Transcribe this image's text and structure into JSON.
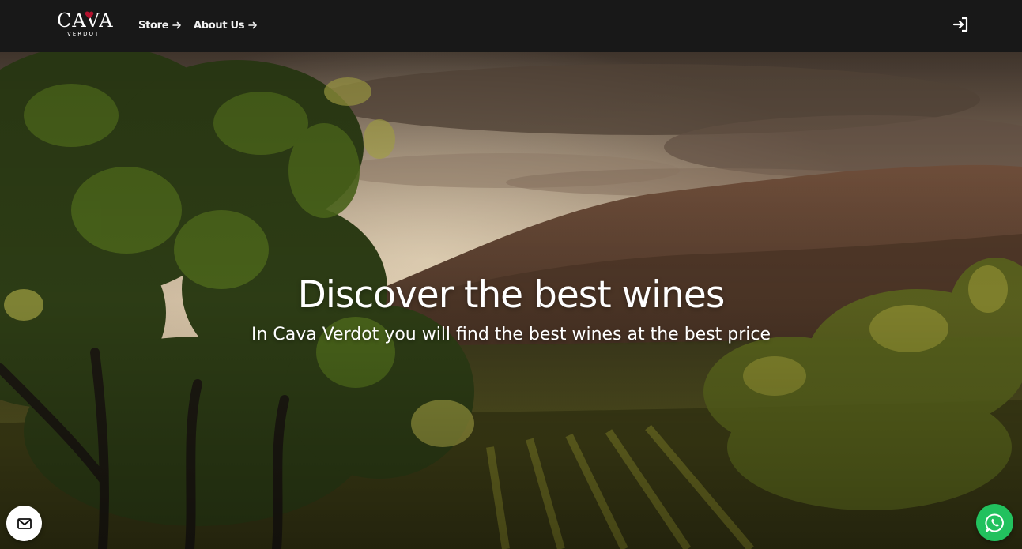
{
  "brand": {
    "logo_text": "CAVA",
    "logo_subtext": "VERDOT"
  },
  "nav": {
    "items": [
      {
        "label": "Store",
        "icon": "arrow-right-icon"
      },
      {
        "label": "About Us",
        "icon": "arrow-right-icon"
      }
    ],
    "login_icon": "login-icon"
  },
  "hero": {
    "title": "Discover the best wines",
    "subtitle": "In Cava Verdot you will find the best wines at the best price"
  },
  "floating": {
    "mail_icon": "mail-icon",
    "whatsapp_icon": "whatsapp-icon"
  },
  "colors": {
    "navbar_bg": "#181818",
    "text": "#ffffff",
    "whatsapp_green": "#22c15e",
    "logo_accent": "#b3122e"
  }
}
